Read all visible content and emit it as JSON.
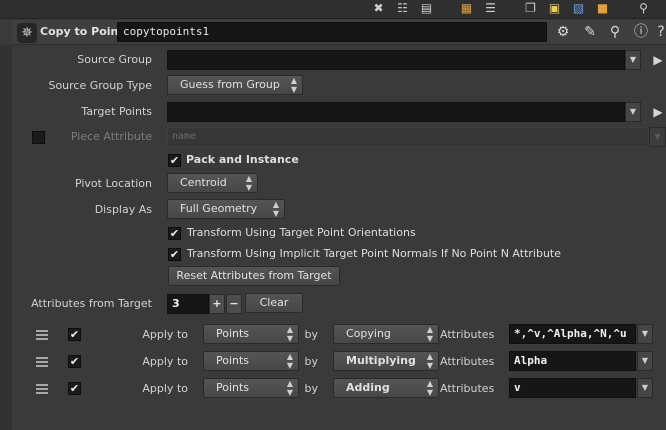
{
  "toolbar": {
    "icons": [
      "tools-icon",
      "parm-list-icon",
      "spreadsheet-icon",
      "color-palette-icon",
      "bookmark-list-icon",
      "window-icon",
      "sticky-note-icon",
      "image-add-icon",
      "package-icon",
      "search-icon"
    ]
  },
  "header": {
    "node_type": "Copy to Points",
    "node_name": "copytopoints1",
    "icons": [
      "gear-icon",
      "brush-icon",
      "search-icon",
      "info-icon",
      "help-icon"
    ]
  },
  "parms": {
    "source_group": {
      "label": "Source Group",
      "value": ""
    },
    "source_group_type": {
      "label": "Source Group Type",
      "value": "Guess from Group"
    },
    "target_points": {
      "label": "Target Points",
      "value": ""
    },
    "piece_attribute": {
      "label": "Piece Attribute",
      "placeholder": "name",
      "enabled": false
    },
    "pack_and_instance": {
      "label": "Pack and Instance",
      "checked": true
    },
    "pivot_location": {
      "label": "Pivot Location",
      "value": "Centroid"
    },
    "display_as": {
      "label": "Display As",
      "value": "Full Geometry"
    },
    "transform_orient": {
      "label": "Transform Using Target Point Orientations",
      "checked": true
    },
    "transform_normals": {
      "label": "Transform Using Implicit Target Point Normals If No Point N Attribute",
      "checked": true
    },
    "reset_button": "Reset Attributes from Target",
    "attributes_from_target": {
      "label": "Attributes from Target",
      "value": "3",
      "plus": "+",
      "minus": "−",
      "clear": "Clear"
    }
  },
  "multiparm": [
    {
      "apply_label": "Apply to",
      "apply_value": "Points",
      "by_label": "by",
      "mode": "Copying",
      "mode_bold": false,
      "attr_label": "Attributes",
      "attrs": "*,^v,^Alpha,^N,^u"
    },
    {
      "apply_label": "Apply to",
      "apply_value": "Points",
      "by_label": "by",
      "mode": "Multiplying",
      "mode_bold": true,
      "attr_label": "Attributes",
      "attrs": "Alpha"
    },
    {
      "apply_label": "Apply to",
      "apply_value": "Points",
      "by_label": "by",
      "mode": "Adding",
      "mode_bold": true,
      "attr_label": "Attributes",
      "attrs": "v"
    }
  ],
  "glyphs": {
    "check": "✔",
    "updown_up": "▲",
    "updown_down": "▼",
    "arrow_down": "▼",
    "side_tri": "▶"
  }
}
